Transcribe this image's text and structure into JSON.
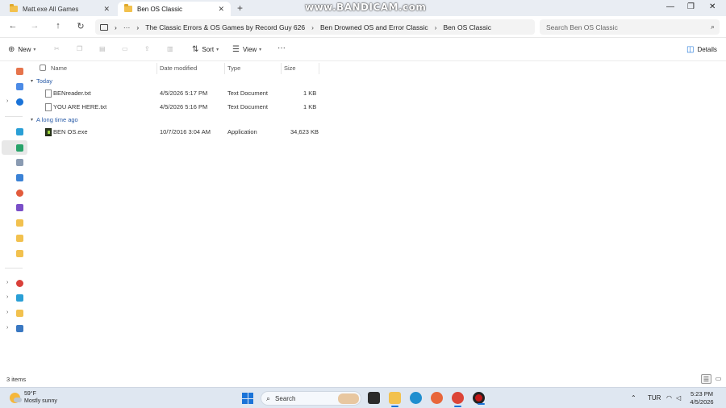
{
  "tabs": [
    {
      "title": "Matt.exe All Games",
      "active": false
    },
    {
      "title": "Ben OS Classic",
      "active": true
    }
  ],
  "watermark": "www.BANDICAM.com",
  "window_controls": {
    "minimize": "—",
    "maximize": "❐",
    "close": "✕"
  },
  "nav": {
    "back": "←",
    "forward": "→",
    "up": "↑",
    "refresh": "↻",
    "more": "···"
  },
  "breadcrumb": [
    "The Classic Errors & OS Games by Record Guy 626",
    "Ben Drowned OS and Error Classic",
    "Ben OS Classic"
  ],
  "search": {
    "placeholder": "Search Ben OS Classic"
  },
  "toolbar": {
    "new_label": "New",
    "sort_label": "Sort",
    "view_label": "View",
    "more_label": "···",
    "details_label": "Details"
  },
  "columns": {
    "name": "Name",
    "date": "Date modified",
    "type": "Type",
    "size": "Size"
  },
  "groups": [
    {
      "label": "Today",
      "files": [
        {
          "name": "BENreader.txt",
          "date": "4/5/2026 5:17 PM",
          "type": "Text Document",
          "size": "1 KB",
          "icon": "text-file-icon"
        },
        {
          "name": "YOU ARE HERE.txt",
          "date": "4/5/2026 5:16 PM",
          "type": "Text Document",
          "size": "1 KB",
          "icon": "text-file-icon"
        }
      ]
    },
    {
      "label": "A long time ago",
      "files": [
        {
          "name": "BEN OS.exe",
          "date": "10/7/2016 3:04 AM",
          "type": "Application",
          "size": "34,623 KB",
          "icon": "application-icon"
        }
      ]
    }
  ],
  "status": {
    "item_count": "3 items"
  },
  "taskbar": {
    "weather_temp": "59°F",
    "weather_condition": "Mostly sunny",
    "search_label": "Search",
    "language": "TUR",
    "time": "5:23 PM",
    "date": "4/5/2026"
  },
  "colors": {
    "accent": "#1a73d8",
    "folder": "#f2c14e",
    "group_label": "#2a5ca8"
  }
}
